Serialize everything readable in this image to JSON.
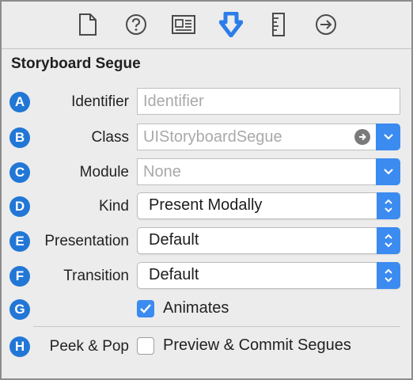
{
  "toolbar": {
    "icons": [
      "file-inspector-icon",
      "quick-help-icon",
      "identity-inspector-icon",
      "attributes-inspector-icon",
      "size-inspector-icon",
      "connections-inspector-icon"
    ]
  },
  "section": {
    "title": "Storyboard Segue"
  },
  "rows": {
    "identifier": {
      "badge": "A",
      "label": "Identifier",
      "placeholder": "Identifier",
      "value": ""
    },
    "class": {
      "badge": "B",
      "label": "Class",
      "placeholder": "UIStoryboardSegue",
      "value": ""
    },
    "module": {
      "badge": "C",
      "label": "Module",
      "placeholder": "None",
      "value": ""
    },
    "kind": {
      "badge": "D",
      "label": "Kind",
      "value": "Present Modally"
    },
    "presentation": {
      "badge": "E",
      "label": "Presentation",
      "value": "Default"
    },
    "transition": {
      "badge": "F",
      "label": "Transition",
      "value": "Default"
    },
    "animates": {
      "badge": "G",
      "label": "Animates",
      "checked": true
    },
    "peek_pop": {
      "badge": "H",
      "label": "Peek & Pop",
      "option_label": "Preview & Commit Segues",
      "checked": false
    }
  },
  "colors": {
    "accent": "#3b8bf0",
    "badge": "#2277d6",
    "panel": "#ececec",
    "active_icon": "#2b7de9"
  }
}
